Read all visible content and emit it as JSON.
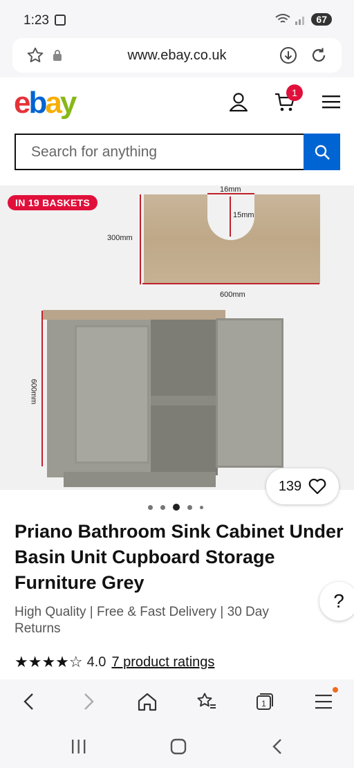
{
  "status": {
    "time": "1:23",
    "battery": "67"
  },
  "browser": {
    "url": "www.ebay.co.uk"
  },
  "header": {
    "logo": [
      "e",
      "b",
      "a",
      "y"
    ],
    "cart_count": "1"
  },
  "search": {
    "placeholder": "Search for anything"
  },
  "gallery": {
    "badge": "IN 19 BASKETS",
    "dims": {
      "notch_width": "16mm",
      "notch_depth": "15mm",
      "depth": "300mm",
      "width": "600mm",
      "height": "600mm"
    },
    "favorites": "139",
    "dot_count": 5,
    "active_dot": 2
  },
  "product": {
    "title": "Priano Bathroom Sink Cabinet Under Basin Unit Cupboard Storage Furniture Grey",
    "subtitle": "High Quality | Free & Fast Delivery | 30 Day Returns",
    "stars": "★★★★☆",
    "rating": "4.0",
    "ratings_link": "7 product ratings"
  },
  "colors": {
    "ebay_blue": "#0064d2",
    "badge_red": "#e0103a",
    "accent_orange": "#f06a1e"
  }
}
